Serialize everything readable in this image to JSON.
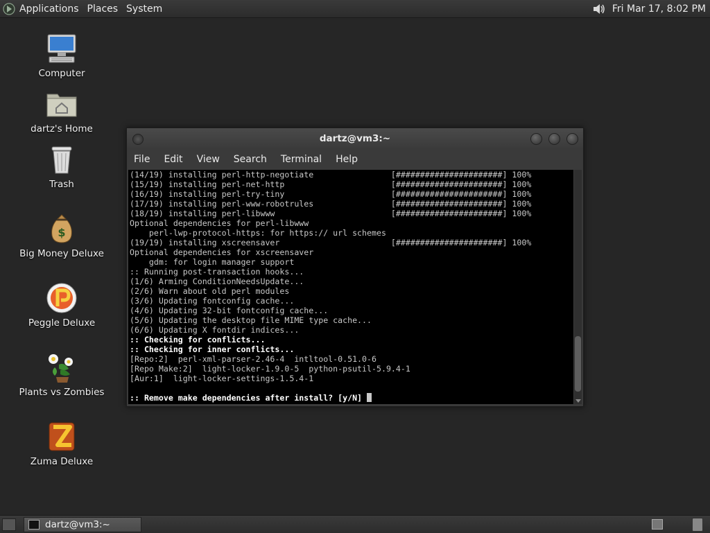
{
  "top_panel": {
    "applications_label": "Applications",
    "places_label": "Places",
    "system_label": "System",
    "clock": "Fri Mar 17,  8:02 PM"
  },
  "desktop": {
    "icons": [
      {
        "label": "Computer",
        "icon": "computer-icon"
      },
      {
        "label": "dartz's Home",
        "icon": "home-folder-icon"
      },
      {
        "label": "Trash",
        "icon": "trash-icon"
      },
      {
        "label": "Big Money Deluxe",
        "icon": "money-bag-icon"
      },
      {
        "label": "Peggle Deluxe",
        "icon": "peggle-icon"
      },
      {
        "label": "Plants vs Zombies",
        "icon": "plants-icon"
      },
      {
        "label": "Zuma Deluxe",
        "icon": "zuma-icon"
      }
    ]
  },
  "terminal": {
    "title": "dartz@vm3:~",
    "menu": [
      "File",
      "Edit",
      "View",
      "Search",
      "Terminal",
      "Help"
    ],
    "lines": [
      "(14/19) installing perl-http-negotiate                [######################] 100%",
      "(15/19) installing perl-net-http                      [######################] 100%",
      "(16/19) installing perl-try-tiny                      [######################] 100%",
      "(17/19) installing perl-www-robotrules                [######################] 100%",
      "(18/19) installing perl-libwww                        [######################] 100%",
      "Optional dependencies for perl-libwww",
      "    perl-lwp-protocol-https: for https:// url schemes",
      "(19/19) installing xscreensaver                       [######################] 100%",
      "Optional dependencies for xscreensaver",
      "    gdm: for login manager support",
      ":: Running post-transaction hooks...",
      "(1/6) Arming ConditionNeedsUpdate...",
      "(2/6) Warn about old perl modules",
      "(3/6) Updating fontconfig cache...",
      "(4/6) Updating 32-bit fontconfig cache...",
      "(5/6) Updating the desktop file MIME type cache...",
      "(6/6) Updating X fontdir indices...",
      ":: Checking for conflicts...",
      ":: Checking for inner conflicts...",
      "[Repo:2]  perl-xml-parser-2.46-4  intltool-0.51.0-6",
      "[Repo Make:2]  light-locker-1.9.0-5  python-psutil-5.9.4-1",
      "[Aur:1]  light-locker-settings-1.5.4-1",
      "",
      ":: Remove make dependencies after install? [y/N] "
    ],
    "bold_lines": [
      17,
      18,
      23
    ]
  },
  "bottom_panel": {
    "task_label": "dartz@vm3:~"
  }
}
